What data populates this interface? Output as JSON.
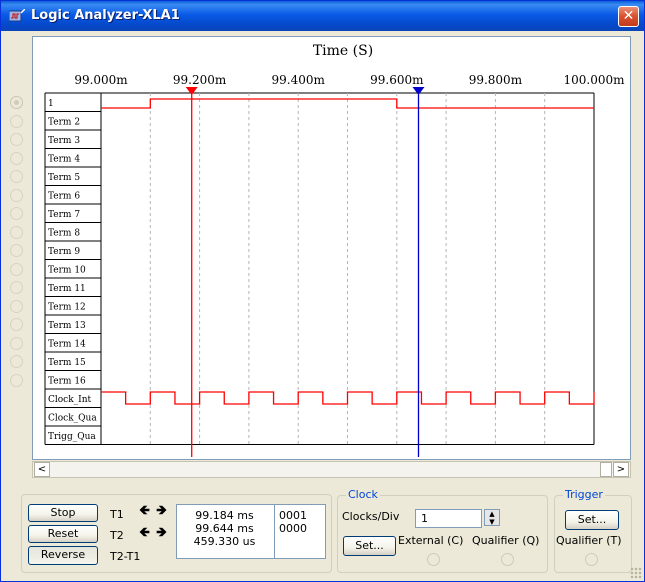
{
  "window": {
    "title": "Logic Analyzer-XLA1",
    "close_glyph": "✕"
  },
  "plot": {
    "title": "Time (S)",
    "time_ticks": [
      "99.000m",
      "99.200m",
      "99.400m",
      "99.600m",
      "99.800m",
      "100.000m"
    ],
    "channels": [
      "1",
      "Term 2",
      "Term 3",
      "Term 4",
      "Term 5",
      "Term 6",
      "Term 7",
      "Term 8",
      "Term 9",
      "Term 10",
      "Term 11",
      "Term 12",
      "Term 13",
      "Term 14",
      "Term 15",
      "Term 16",
      "Clock_Int",
      "Clock_Qua",
      "Trigg_Qua"
    ],
    "colors": {
      "trace": "#FF0000",
      "cursor1": "#FF0000",
      "cursor2": "#0000CC",
      "grid": "#B4B4B4"
    }
  },
  "chart_data": {
    "type": "line",
    "title": "Time (S)",
    "xlabel": "Time (S)",
    "x_ticks": [
      "99.000m",
      "99.200m",
      "99.400m",
      "99.600m",
      "99.800m",
      "100.000m"
    ],
    "xlim": [
      99.0,
      100.0
    ],
    "x_unit": "ms",
    "series": [
      {
        "name": "1",
        "steps": [
          [
            99.0,
            1
          ],
          [
            99.1,
            0
          ],
          [
            99.6,
            1
          ],
          [
            100.0,
            1
          ]
        ],
        "note_high_is_low_on_screen": false
      },
      {
        "name": "Clock_Int",
        "period": 0.1,
        "edges_start": 99.1
      }
    ],
    "cursors": [
      {
        "name": "T1",
        "x": 99.184,
        "color": "#FF0000"
      },
      {
        "name": "T2",
        "x": 99.644,
        "color": "#0000CC"
      }
    ]
  },
  "controls": {
    "buttons": {
      "stop": "Stop",
      "reset": "Reset",
      "reverse": "Reverse"
    },
    "cursor_labels": {
      "t1": "T1",
      "t2": "T2",
      "diff": "T2-T1"
    },
    "cursor_values": {
      "t1": "99.184 ms",
      "t2": "99.644 ms",
      "diff": "459.330 us"
    },
    "cursor_hex": {
      "t1": "0001",
      "t2": "0000"
    },
    "arrow_left": "🡸",
    "arrow_right": "🡺"
  },
  "clock": {
    "title": "Clock",
    "clocks_div_label": "Clocks/Div",
    "clocks_div_value": "1",
    "set_label": "Set...",
    "external_label": "External (C)",
    "qualifier_label": "Qualifier (Q)"
  },
  "trigger": {
    "title": "Trigger",
    "set_label": "Set...",
    "qualifier_label": "Qualifier (T)"
  },
  "scrollbar": {
    "left": "<",
    "right": ">"
  }
}
